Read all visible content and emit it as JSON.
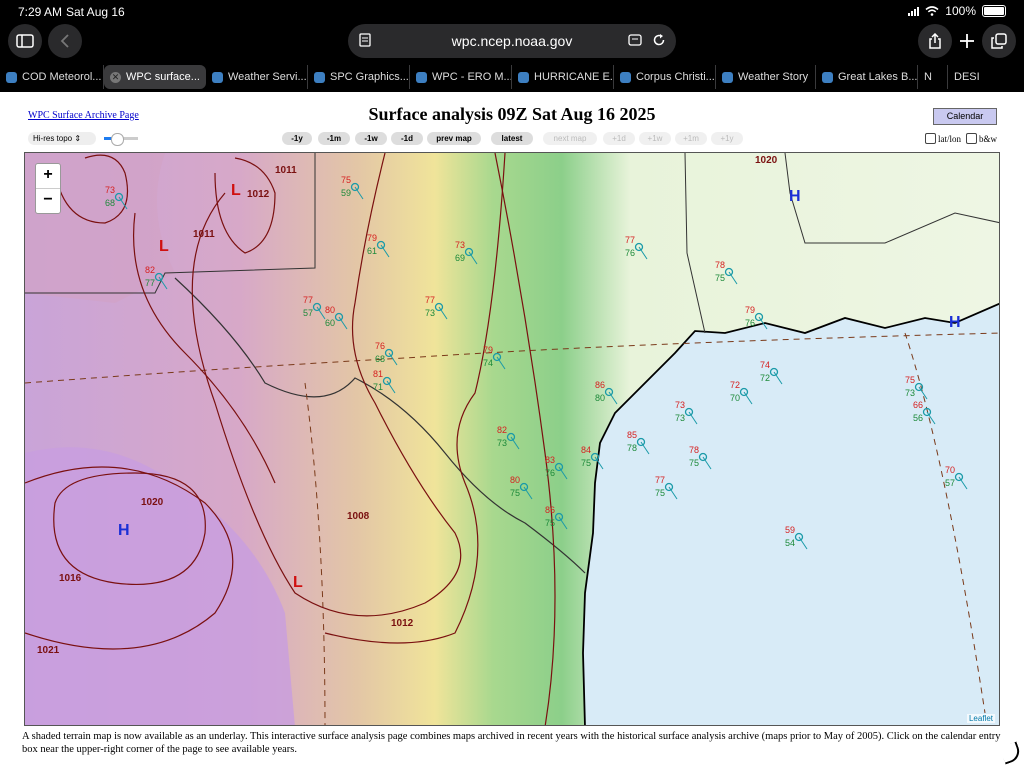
{
  "status_bar": {
    "time": "7:29 AM",
    "date": "Sat Aug 16",
    "battery": "100%"
  },
  "browser": {
    "url": "wpc.ncep.noaa.gov",
    "tabs": [
      {
        "label": "COD Meteorol...",
        "active": false
      },
      {
        "label": "WPC surface...",
        "active": true
      },
      {
        "label": "Weather Servi...",
        "active": false
      },
      {
        "label": "SPC Graphics...",
        "active": false
      },
      {
        "label": "WPC - ERO M...",
        "active": false
      },
      {
        "label": "HURRICANE E...",
        "active": false
      },
      {
        "label": "Corpus Christi...",
        "active": false
      },
      {
        "label": "Weather Story",
        "active": false
      },
      {
        "label": "Great Lakes B...",
        "active": false
      },
      {
        "label": "N",
        "active": false
      },
      {
        "label": "DESI",
        "active": false
      }
    ]
  },
  "page": {
    "archive_link": "WPC Surface Archive Page",
    "title": "Surface analysis 09Z Sat Aug 16 2025",
    "calendar_button": "Calendar",
    "underlay_select": "Hi-res topo",
    "opacity": 0.35,
    "nav_buttons": [
      {
        "label": "-1y",
        "enabled": true
      },
      {
        "label": "-1m",
        "enabled": true
      },
      {
        "label": "-1w",
        "enabled": true
      },
      {
        "label": "-1d",
        "enabled": true
      },
      {
        "label": "prev map",
        "enabled": true
      },
      {
        "label": "latest",
        "enabled": true
      },
      {
        "label": "next map",
        "enabled": false
      },
      {
        "label": "+1d",
        "enabled": false
      },
      {
        "label": "+1w",
        "enabled": false
      },
      {
        "label": "+1m",
        "enabled": false
      },
      {
        "label": "+1y",
        "enabled": false
      }
    ],
    "checkbox_latlon": "lat/lon",
    "checkbox_bw": "b&w",
    "zoom_in": "+",
    "zoom_out": "−",
    "attribution": "Leaflet",
    "footer_note": "A shaded terrain map is now available as an underlay. This interactive surface analysis page combines maps archived in recent years with the historical surface analysis archive (maps prior to May of 2005). Click on the calendar entry box near the upper-right corner of the page to see available years."
  },
  "map": {
    "high_centers": [
      "H",
      "H",
      "H"
    ],
    "low_centers": [
      "L",
      "L",
      "L"
    ],
    "isobar_labels": [
      "1011",
      "1011",
      "1012",
      "1020",
      "1020",
      "1016",
      "1008",
      "1012",
      "1021"
    ],
    "colors": {
      "isobar": "#7a1010",
      "high": "#1a2fd6",
      "low": "#d01010",
      "temp": "#d62020",
      "dewpoint": "#1d8a3a",
      "pressure": "#c86414",
      "coast": "#000000",
      "water": "#d8ebf7"
    },
    "obs_samples": [
      {
        "t": "75",
        "d": "59"
      },
      {
        "t": "79",
        "d": "61"
      },
      {
        "t": "77",
        "d": "57"
      },
      {
        "t": "80",
        "d": "60"
      },
      {
        "t": "76",
        "d": "68"
      },
      {
        "t": "81",
        "d": "71"
      },
      {
        "t": "73",
        "d": "69"
      },
      {
        "t": "77",
        "d": "73"
      },
      {
        "t": "79",
        "d": "74"
      },
      {
        "t": "82",
        "d": "73"
      },
      {
        "t": "80",
        "d": "75"
      },
      {
        "t": "83",
        "d": "76"
      },
      {
        "t": "86",
        "d": "75"
      },
      {
        "t": "84",
        "d": "75"
      },
      {
        "t": "86",
        "d": "80"
      },
      {
        "t": "85",
        "d": "78"
      },
      {
        "t": "78",
        "d": "75"
      },
      {
        "t": "73",
        "d": "73"
      },
      {
        "t": "72",
        "d": "70"
      },
      {
        "t": "74",
        "d": "72"
      },
      {
        "t": "75",
        "d": "73"
      },
      {
        "t": "70",
        "d": "57"
      },
      {
        "t": "59",
        "d": "54"
      },
      {
        "t": "66",
        "d": "56"
      },
      {
        "t": "78",
        "d": "75"
      },
      {
        "t": "79",
        "d": "76"
      },
      {
        "t": "77",
        "d": "76"
      },
      {
        "t": "82",
        "d": "77"
      },
      {
        "t": "73",
        "d": "68"
      },
      {
        "t": "77",
        "d": "75"
      }
    ]
  }
}
